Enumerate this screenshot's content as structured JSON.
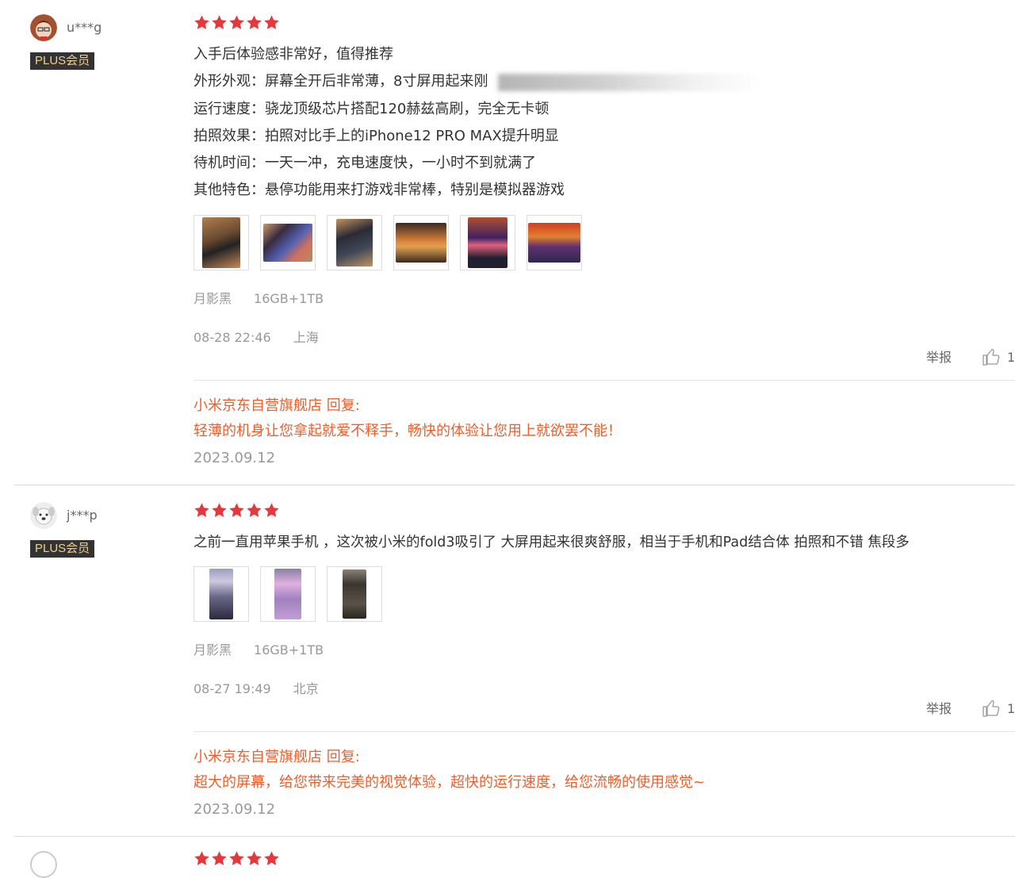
{
  "reviews": [
    {
      "username": "u***g",
      "badge": "PLUS会员",
      "rating": 5,
      "lines": [
        "入手后体验感非常好，值得推荐",
        "外形外观：屏幕全开后非常薄，8寸屏用起来刚",
        "运行速度：骁龙顶级芯片搭配120赫兹高刷，完全无卡顿",
        "拍照效果：拍照对比手上的iPhone12 PRO MAX提升明显",
        "待机时间：一天一冲，充电速度快，一小时不到就满了",
        "其他特色：悬停功能用来打游戏非常棒，特别是模拟器游戏"
      ],
      "color": "月影黑",
      "spec": "16GB+1TB",
      "date": "08-28 22:46",
      "location": "上海",
      "report_label": "举报",
      "likes": "1",
      "reply_title": "小米京东自营旗舰店 回复:",
      "reply_text": "轻薄的机身让您拿起就爱不释手，畅快的体验让您用上就欲罢不能！",
      "reply_date": "2023.09.12"
    },
    {
      "username": "j***p",
      "badge": "PLUS会员",
      "rating": 5,
      "lines": [
        "之前一直用苹果手机 ，这次被小米的fold3吸引了 大屏用起来很爽舒服，相当于手机和Pad结合体 拍照和不错 焦段多"
      ],
      "color": "月影黑",
      "spec": "16GB+1TB",
      "date": "08-27 19:49",
      "location": "北京",
      "report_label": "举报",
      "likes": "1",
      "reply_title": "小米京东自营旗舰店 回复:",
      "reply_text": "超大的屏幕，给您带来完美的视觉体验，超快的运行速度，给您流畅的使用感觉~",
      "reply_date": "2023.09.12"
    }
  ],
  "colors": {
    "star": "#e4393c",
    "reply": "#ec5f2b",
    "badge_bg": "#333333",
    "badge_text": "#f1cf8c"
  }
}
